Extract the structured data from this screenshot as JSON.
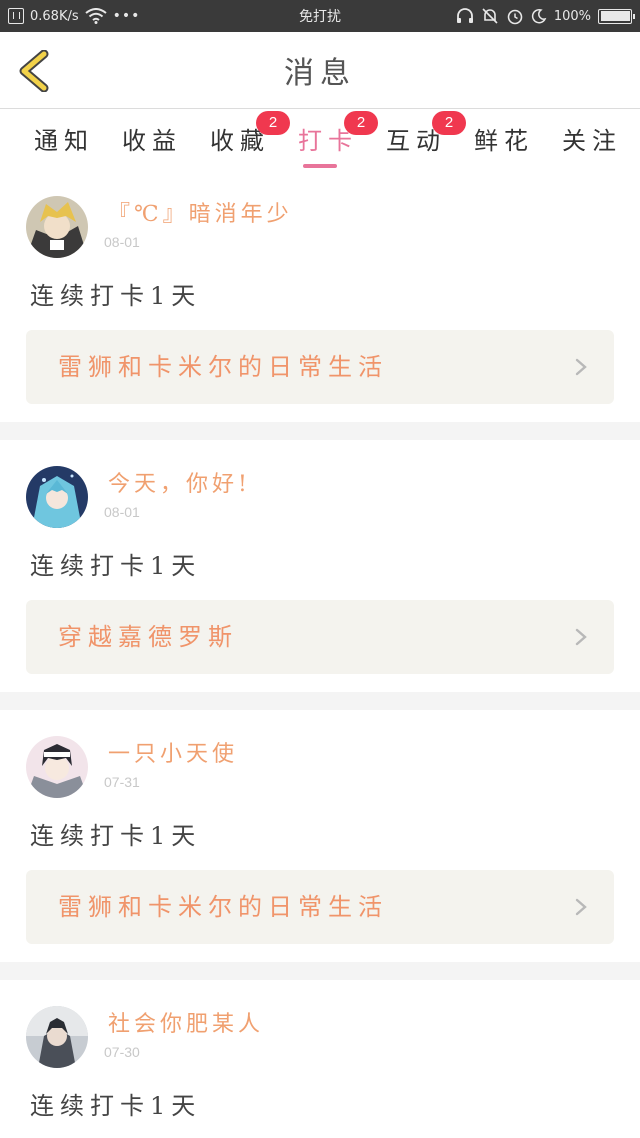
{
  "status_bar": {
    "speed": "0.68K/s",
    "center_title": "免打扰",
    "battery": "100%",
    "dots": "•••",
    "battery_level": 1.0
  },
  "header": {
    "title": "消息"
  },
  "tabs": [
    {
      "label": "通知",
      "badge": ""
    },
    {
      "label": "收益",
      "badge": ""
    },
    {
      "label": "收藏",
      "badge": "2"
    },
    {
      "label": "打卡",
      "badge": "2",
      "active": true
    },
    {
      "label": "互动",
      "badge": "2"
    },
    {
      "label": "鲜花",
      "badge": ""
    },
    {
      "label": "关注",
      "badge": ""
    }
  ],
  "feed": [
    {
      "username": "『℃』暗消年少",
      "date": "08-01",
      "text": "连续打卡1天",
      "link": "雷狮和卡米尔的日常生活"
    },
    {
      "username": "今天，你好!",
      "date": "08-01",
      "text": "连续打卡1天",
      "link": "穿越嘉德罗斯"
    },
    {
      "username": "一只小天使",
      "date": "07-31",
      "text": "连续打卡1天",
      "link": "雷狮和卡米尔的日常生活"
    },
    {
      "username": "社会你肥某人",
      "date": "07-30",
      "text": "连续打卡1天",
      "link": ""
    }
  ],
  "colors": {
    "accent": "#e8749a",
    "badge": "#f0384f",
    "username": "#f0a070",
    "link": "#f0946a",
    "back_arrow": "#f2d24a"
  }
}
